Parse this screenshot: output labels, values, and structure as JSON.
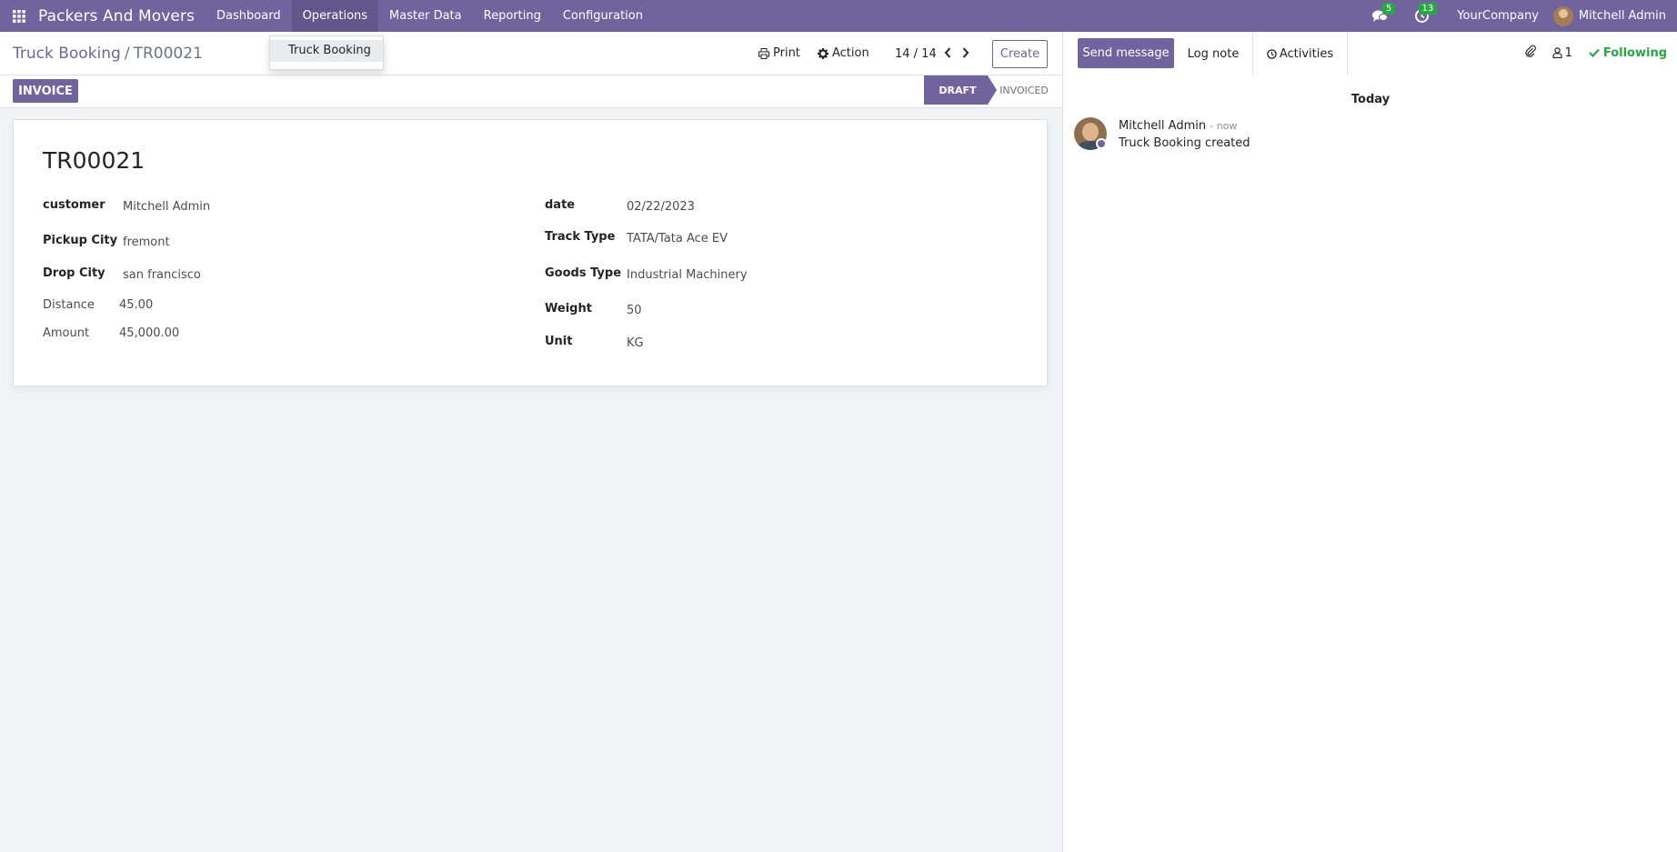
{
  "navbar": {
    "app_name": "Packers And Movers",
    "menu": [
      {
        "label": "Dashboard"
      },
      {
        "label": "Operations"
      },
      {
        "label": "Master Data"
      },
      {
        "label": "Reporting"
      },
      {
        "label": "Configuration"
      }
    ],
    "messages_count": "5",
    "activities_count": "13",
    "company": "YourCompany",
    "user": "Mitchell Admin",
    "color": "#71639e"
  },
  "dropdown": {
    "items": [
      {
        "label": "Truck Booking"
      }
    ]
  },
  "control": {
    "breadcrumb_parent": "Truck Booking",
    "breadcrumb_sep": "/",
    "breadcrumb_current": "TR00021",
    "print_label": "Print",
    "action_label": "Action",
    "pager": "14 / 14",
    "create_label": "Create"
  },
  "statusbar": {
    "invoice_label": "INVOICE",
    "stages": [
      {
        "label": "DRAFT",
        "active": true
      },
      {
        "label": "INVOICED",
        "active": false
      }
    ]
  },
  "form": {
    "name": "TR00021",
    "left": {
      "customer_label": "customer",
      "customer": "Mitchell Admin",
      "pickup_label": "Pickup City",
      "pickup": "fremont",
      "drop_label": "Drop City",
      "drop": "san francisco",
      "distance_label": "Distance",
      "distance": "45.00",
      "amount_label": "Amount",
      "amount": "45,000.00"
    },
    "right": {
      "date_label": "date",
      "date": "02/22/2023",
      "track_label": "Track Type",
      "track": "TATA/Tata Ace EV",
      "goods_label": "Goods Type",
      "goods": "Industrial Machinery",
      "weight_label": "Weight",
      "weight": "50",
      "unit_label": "Unit",
      "unit": "KG"
    }
  },
  "chatter": {
    "send_label": "Send message",
    "log_label": "Log note",
    "activities_label": "Activities",
    "followers_count": "1",
    "following_label": "Following",
    "date_separator": "Today",
    "messages": [
      {
        "author": "Mitchell Admin",
        "time": "- now",
        "body": "Truck Booking created"
      }
    ]
  }
}
